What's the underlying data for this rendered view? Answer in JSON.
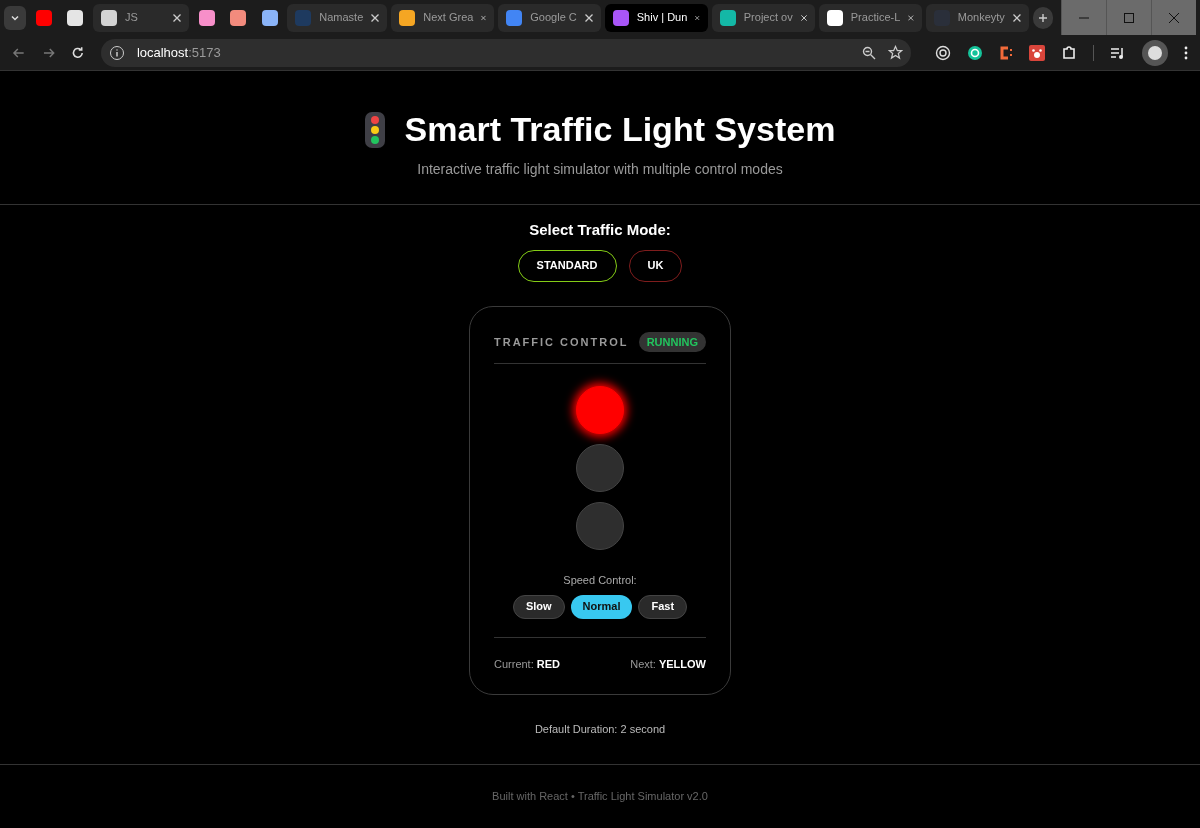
{
  "browser": {
    "tabs": [
      {
        "kind": "pinned",
        "color": "#ff0000",
        "selected": false
      },
      {
        "kind": "pinned",
        "color": "#e5e5e5",
        "selected": false
      },
      {
        "kind": "tab",
        "title": "JS",
        "color": "#d4d4d4",
        "selected": false
      },
      {
        "kind": "pinned",
        "color": "#f78fc9",
        "selected": false
      },
      {
        "kind": "pinned",
        "color": "#f28b7d",
        "selected": false
      },
      {
        "kind": "pinned",
        "color": "#8ab4f8",
        "selected": false
      },
      {
        "kind": "tab",
        "title": "Namaste",
        "color": "#1e3a5f",
        "selected": false
      },
      {
        "kind": "tab",
        "title": "Next Grea",
        "color": "#f5a623",
        "selected": false
      },
      {
        "kind": "tab",
        "title": "Google C",
        "color": "#4285f4",
        "selected": false
      },
      {
        "kind": "tab",
        "title": "Shiv | Dun",
        "color": "#a855f7",
        "selected": true
      },
      {
        "kind": "tab",
        "title": "Project ov",
        "color": "#14b8a6",
        "selected": false
      },
      {
        "kind": "tab",
        "title": "Practice-L",
        "color": "#ffffff",
        "selected": false
      },
      {
        "kind": "tab",
        "title": "Monkeyty",
        "color": "#2a2f3a",
        "selected": false
      }
    ],
    "address": {
      "host": "localhost",
      "port": ":5173"
    }
  },
  "header": {
    "title": "Smart Traffic Light System",
    "subtitle": "Interactive traffic light simulator with multiple control modes"
  },
  "mode_selector": {
    "label": "Select Traffic Mode:",
    "modes": [
      {
        "label": "STANDARD",
        "color": "#84cc16"
      },
      {
        "label": "UK",
        "color": "#7f1d1d"
      }
    ]
  },
  "control": {
    "title": "TRAFFIC CONTROL",
    "status": "RUNNING",
    "lights": [
      {
        "color": "#ff0000",
        "on": true
      },
      {
        "on": false
      },
      {
        "on": false
      }
    ],
    "speed_label": "Speed Control:",
    "speeds": [
      {
        "label": "Slow",
        "selected": false
      },
      {
        "label": "Normal",
        "selected": true
      },
      {
        "label": "Fast",
        "selected": false
      }
    ],
    "current": "Current: **RED**",
    "next": "Next: **YELLOW**"
  },
  "duration": "Default Duration: 2 second",
  "footer": "Built with React • Traffic Light Simulator v2.0"
}
